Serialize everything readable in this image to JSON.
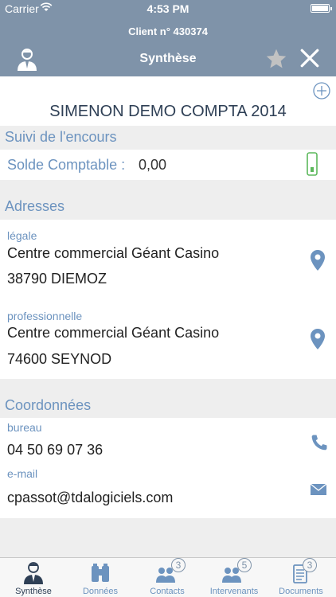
{
  "status_bar": {
    "carrier": "Carrier",
    "time": "4:53 PM"
  },
  "header": {
    "client_number": "Client n° 430374",
    "title": "Synthèse"
  },
  "company": {
    "name": "SIMENON DEMO COMPTA 2014"
  },
  "suivi": {
    "section_title": "Suivi de l'encours",
    "solde_label": "Solde Comptable :",
    "solde_value": "0,00"
  },
  "adresses": {
    "section_title": "Adresses",
    "items": [
      {
        "type": "légale",
        "line1": "Centre commercial Géant Casino",
        "line2": "38790 DIEMOZ"
      },
      {
        "type": "professionnelle",
        "line1": "Centre commercial Géant Casino",
        "line2": "74600 SEYNOD"
      }
    ]
  },
  "coordonnees": {
    "section_title": "Coordonnées",
    "phone_label": "bureau",
    "phone_value": "04 50 69 07 36",
    "email_label": "e-mail",
    "email_value": "cpassot@tdalogiciels.com"
  },
  "tabs": [
    {
      "label": "Synthèse",
      "icon": "person-icon",
      "active": true
    },
    {
      "label": "Données",
      "icon": "binoculars-icon"
    },
    {
      "label": "Contacts",
      "icon": "contacts-icon",
      "badge": "3"
    },
    {
      "label": "Intervenants",
      "icon": "intervenants-icon",
      "badge": "5"
    },
    {
      "label": "Documents",
      "icon": "documents-icon",
      "badge": "3"
    }
  ],
  "colors": {
    "header_bg": "#7f93a9",
    "accent_blue": "#6c93bf",
    "dark_text": "#2e3f55",
    "status_green": "#5cb85c"
  }
}
